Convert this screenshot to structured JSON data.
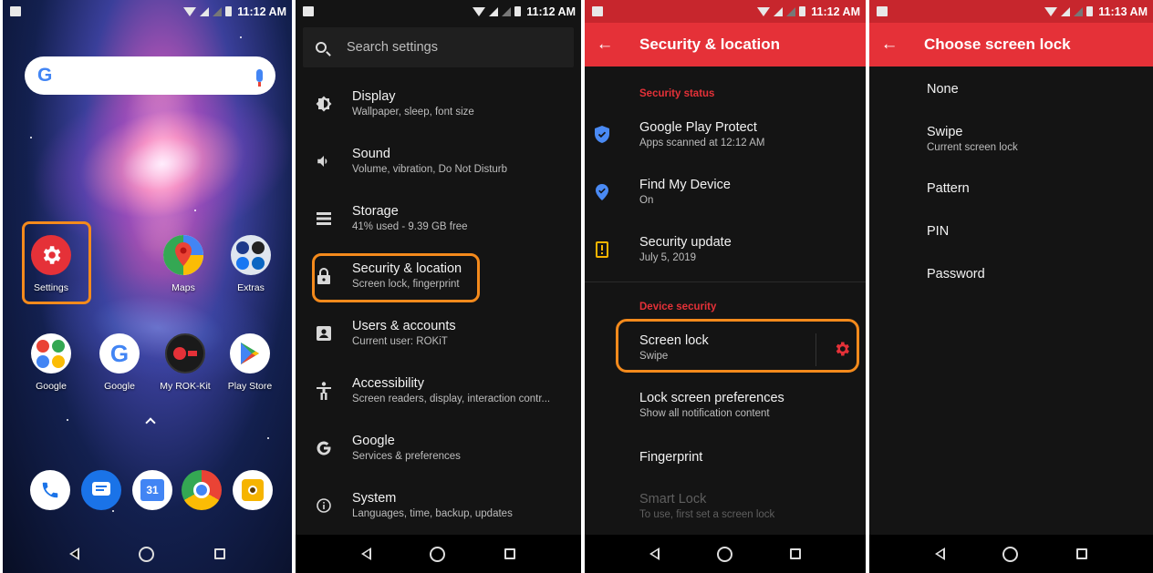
{
  "status": {
    "time_1": "11:12 AM",
    "time_2": "11:12 AM",
    "time_3": "11:12 AM",
    "time_4": "11:13 AM"
  },
  "home": {
    "apps": [
      {
        "label": "Settings"
      },
      {
        "label": "Maps"
      },
      {
        "label": "Extras"
      },
      {
        "label": "Google"
      },
      {
        "label": "Google"
      },
      {
        "label": "My ROK-Kit"
      },
      {
        "label": "Play Store"
      }
    ],
    "dock_calendar_day": "31",
    "g_logo": "G",
    "google_g": "G"
  },
  "settings": {
    "search_placeholder": "Search settings",
    "items": [
      {
        "title": "Display",
        "subtitle": "Wallpaper, sleep, font size",
        "icon": "brightness-icon"
      },
      {
        "title": "Sound",
        "subtitle": "Volume, vibration, Do Not Disturb",
        "icon": "volume-icon"
      },
      {
        "title": "Storage",
        "subtitle": "41% used - 9.39 GB free",
        "icon": "storage-icon"
      },
      {
        "title": "Security & location",
        "subtitle": "Screen lock, fingerprint",
        "icon": "lock-icon"
      },
      {
        "title": "Users & accounts",
        "subtitle": "Current user: ROKiT",
        "icon": "account-icon"
      },
      {
        "title": "Accessibility",
        "subtitle": "Screen readers, display, interaction contr...",
        "icon": "accessibility-icon"
      },
      {
        "title": "Google",
        "subtitle": "Services & preferences",
        "icon": "google-icon"
      },
      {
        "title": "System",
        "subtitle": "Languages, time, backup, updates",
        "icon": "info-icon"
      }
    ]
  },
  "security": {
    "title": "Security & location",
    "section_status": "Security status",
    "section_device": "Device security",
    "items": [
      {
        "title": "Google Play Protect",
        "subtitle": "Apps scanned at 12:12 AM"
      },
      {
        "title": "Find My Device",
        "subtitle": "On"
      },
      {
        "title": "Security update",
        "subtitle": "July 5, 2019"
      },
      {
        "title": "Screen lock",
        "subtitle": "Swipe"
      },
      {
        "title": "Lock screen preferences",
        "subtitle": "Show all notification content"
      },
      {
        "title": "Fingerprint",
        "subtitle": ""
      },
      {
        "title": "Smart Lock",
        "subtitle": "To use, first set a screen lock"
      }
    ]
  },
  "screenlock": {
    "title": "Choose screen lock",
    "options": [
      {
        "title": "None",
        "subtitle": ""
      },
      {
        "title": "Swipe",
        "subtitle": "Current screen lock"
      },
      {
        "title": "Pattern",
        "subtitle": ""
      },
      {
        "title": "PIN",
        "subtitle": ""
      },
      {
        "title": "Password",
        "subtitle": ""
      }
    ]
  },
  "colors": {
    "accent_red": "#e53138",
    "highlight_orange": "#f48a1c",
    "background": "#141414"
  }
}
